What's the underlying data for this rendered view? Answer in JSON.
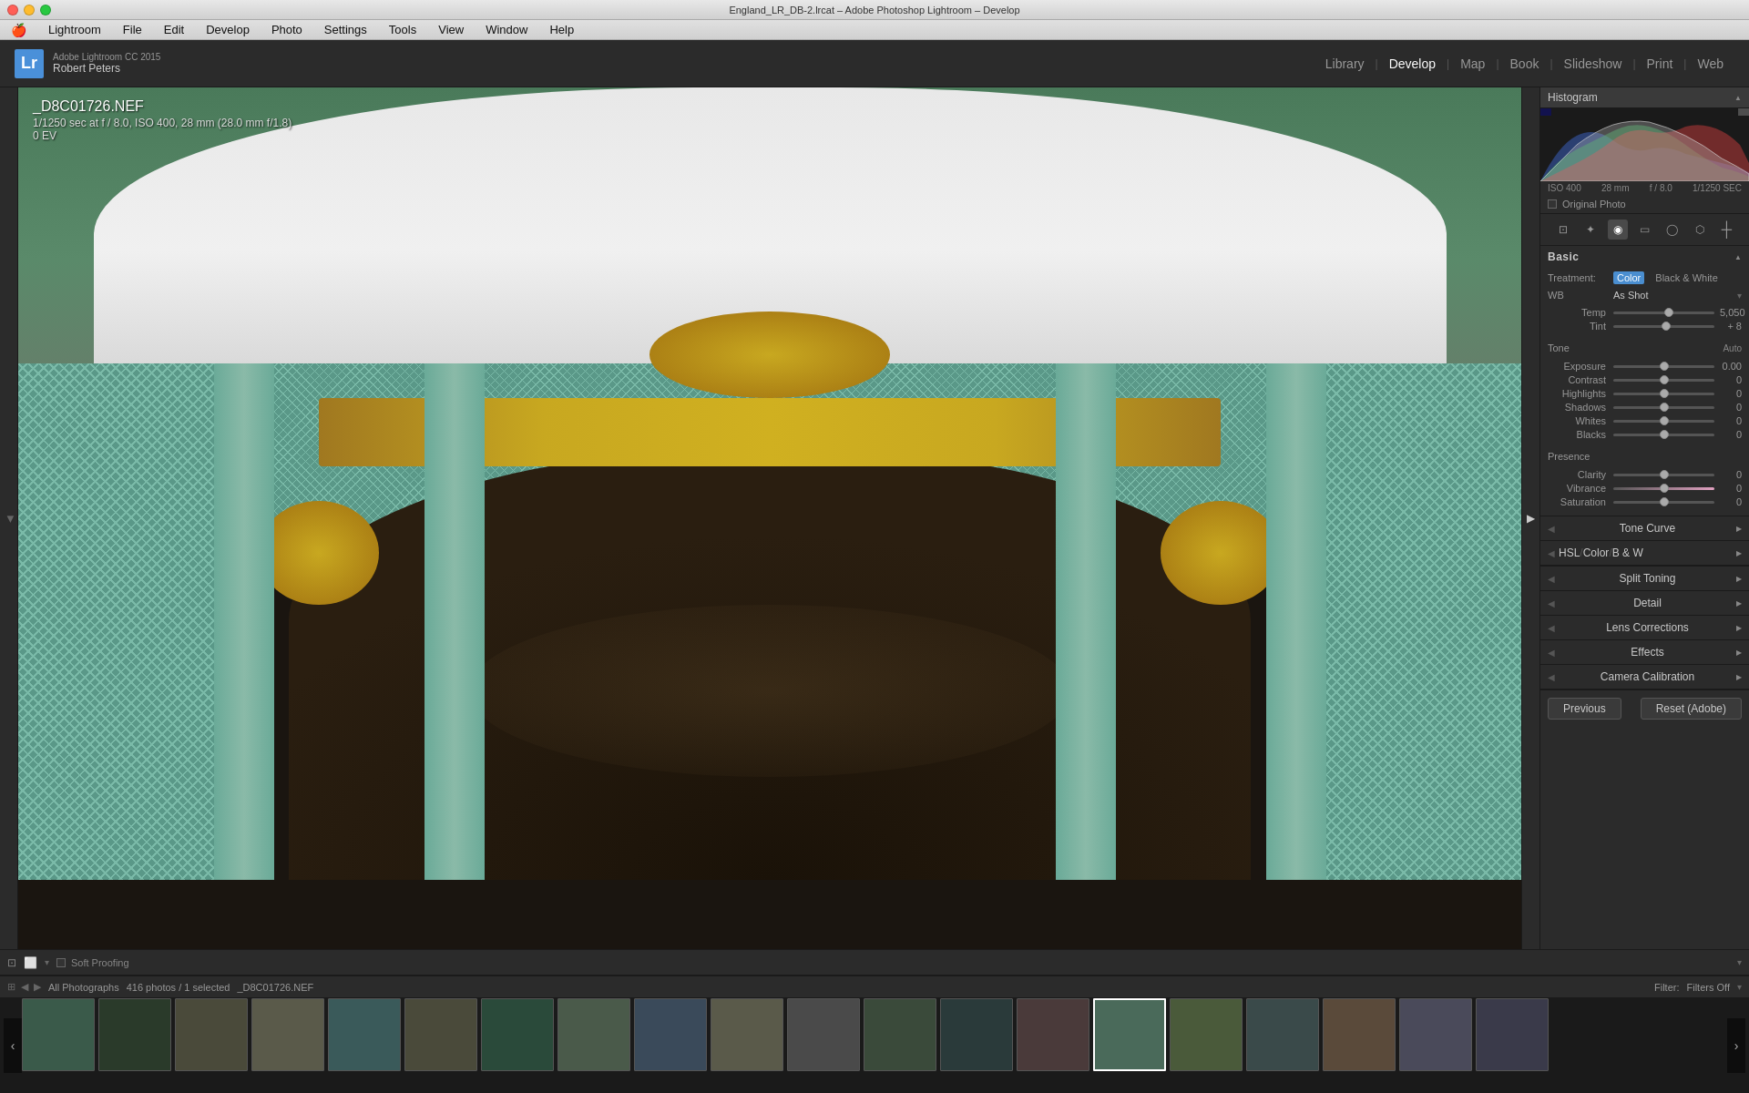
{
  "window": {
    "title": "England_LR_DB-2.lrcat – Adobe Photoshop Lightroom – Develop"
  },
  "titlebar": {
    "buttons": [
      "close",
      "minimize",
      "maximize"
    ]
  },
  "menubar": {
    "apple": "⌘",
    "items": [
      "Lightroom",
      "File",
      "Edit",
      "Develop",
      "Photo",
      "Settings",
      "Tools",
      "View",
      "Window",
      "Help"
    ]
  },
  "header": {
    "app_name": "Adobe Lightroom CC 2015",
    "user": "Robert Peters",
    "nav_items": [
      "Library",
      "Develop",
      "Map",
      "Book",
      "Slideshow",
      "Print",
      "Web"
    ],
    "active_nav": "Develop",
    "separators": [
      "|",
      "|",
      "|",
      "|",
      "|",
      "|"
    ]
  },
  "photo": {
    "filename": "_D8C01726.NEF",
    "shutter": "1/1250",
    "aperture": "f / 8.0",
    "iso": "ISO 400",
    "focal_length": "28 mm (28.0 mm f/1.8)",
    "ev": "0 EV"
  },
  "histogram": {
    "title": "Histogram",
    "iso": "ISO 400",
    "focal": "28 mm",
    "aperture": "f / 8.0",
    "shutter": "1/1250 SEC",
    "original_photo_label": "Original Photo"
  },
  "tools": {
    "icons": [
      "crop",
      "heal",
      "red-eye",
      "graduated",
      "radial",
      "adjustment",
      "color"
    ]
  },
  "basic_panel": {
    "title": "Basic",
    "treatment_label": "Treatment:",
    "color_option": "Color",
    "bw_option": "Black & White",
    "wb_label": "WB",
    "wb_value": "As Shot",
    "temp_label": "Temp",
    "temp_value": "5,050",
    "tint_label": "Tint",
    "tint_value": "+ 8",
    "tone_label": "Tone",
    "tone_auto": "Auto",
    "exposure_label": "Exposure",
    "exposure_value": "0.00",
    "contrast_label": "Contrast",
    "contrast_value": "0",
    "highlights_label": "Highlights",
    "highlights_value": "0",
    "shadows_label": "Shadows",
    "shadows_value": "0",
    "whites_label": "Whites",
    "whites_value": "0",
    "blacks_label": "Blacks",
    "blacks_value": "0",
    "presence_label": "Presence",
    "clarity_label": "Clarity",
    "clarity_value": "0",
    "vibrance_label": "Vibrance",
    "vibrance_value": "0",
    "saturation_label": "Saturation",
    "saturation_value": "0"
  },
  "panels": {
    "tone_curve": "Tone Curve",
    "hsl": "HSL",
    "color": "Color",
    "bw": "B & W",
    "split_toning": "Split Toning",
    "detail": "Detail",
    "lens_corrections": "Lens Corrections",
    "effects": "Effects",
    "camera_calibration": "Camera Calibration"
  },
  "filmstrip": {
    "all_photos": "All Photographs",
    "count": "416 photos / 1 selected",
    "selected_file": "_D8C01726.NEF",
    "filter_label": "Filter:",
    "filter_value": "Filters Off"
  },
  "bottom_toolbar": {
    "soft_proofing": "Soft Proofing"
  },
  "action_buttons": {
    "previous": "Previous",
    "reset": "Reset (Adobe)"
  },
  "filmstrip_thumbs": [
    {
      "id": 1,
      "color": "#3a5a4a"
    },
    {
      "id": 2,
      "color": "#2a3a2a"
    },
    {
      "id": 3,
      "color": "#4a4a3a"
    },
    {
      "id": 4,
      "color": "#5a5a4a"
    },
    {
      "id": 5,
      "color": "#3a5a5a"
    },
    {
      "id": 6,
      "color": "#4a4a3a"
    },
    {
      "id": 7,
      "color": "#2a4a3a"
    },
    {
      "id": 8,
      "color": "#4a5a4a"
    },
    {
      "id": 9,
      "color": "#3a4a5a"
    },
    {
      "id": 10,
      "color": "#5a5a4a"
    },
    {
      "id": 11,
      "color": "#4a4a4a"
    },
    {
      "id": 12,
      "color": "#3a4a3a"
    },
    {
      "id": 13,
      "color": "#2a3a3a"
    },
    {
      "id": 14,
      "color": "#4a3a3a"
    },
    {
      "id": 15,
      "color": "#3a5a4a",
      "selected": true
    },
    {
      "id": 16,
      "color": "#4a5a3a"
    },
    {
      "id": 17,
      "color": "#3a4a4a"
    },
    {
      "id": 18,
      "color": "#5a4a3a"
    },
    {
      "id": 19,
      "color": "#4a4a5a"
    },
    {
      "id": 20,
      "color": "#3a3a4a"
    }
  ]
}
